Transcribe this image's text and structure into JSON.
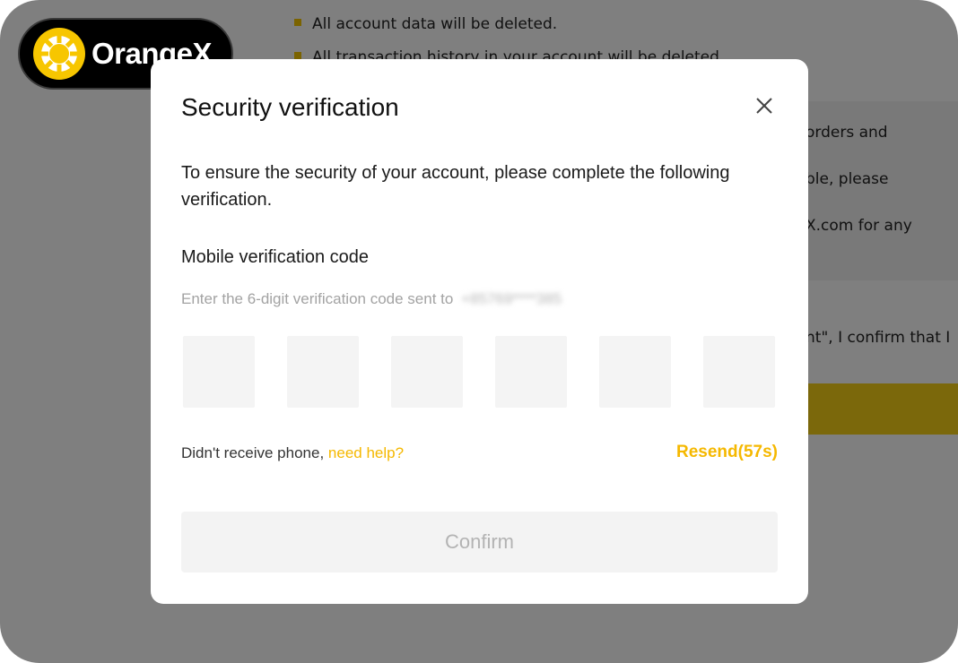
{
  "brand": {
    "name": "OrangeX",
    "logo_icon": "orangex-logo-icon",
    "accent": "#f5b800"
  },
  "background_page": {
    "bullets": [
      "All account data will be deleted.",
      "All transaction history in your account will be deleted."
    ],
    "partial_lines": [
      "orders and",
      "ble, please",
      "X.com for any",
      "nt\", I confirm that I"
    ]
  },
  "modal": {
    "title": "Security verification",
    "close_icon": "close-icon",
    "description": "To ensure the security of your account, please complete the following verification.",
    "field_label": "Mobile verification code",
    "hint": "Enter the 6-digit verification code sent to",
    "masked_phone": "+85769****385",
    "code_digits": [
      "",
      "",
      "",
      "",
      "",
      ""
    ],
    "help_prefix": "Didn't receive phone,",
    "help_link": "need help?",
    "resend": "Resend(57s)",
    "confirm": "Confirm"
  }
}
